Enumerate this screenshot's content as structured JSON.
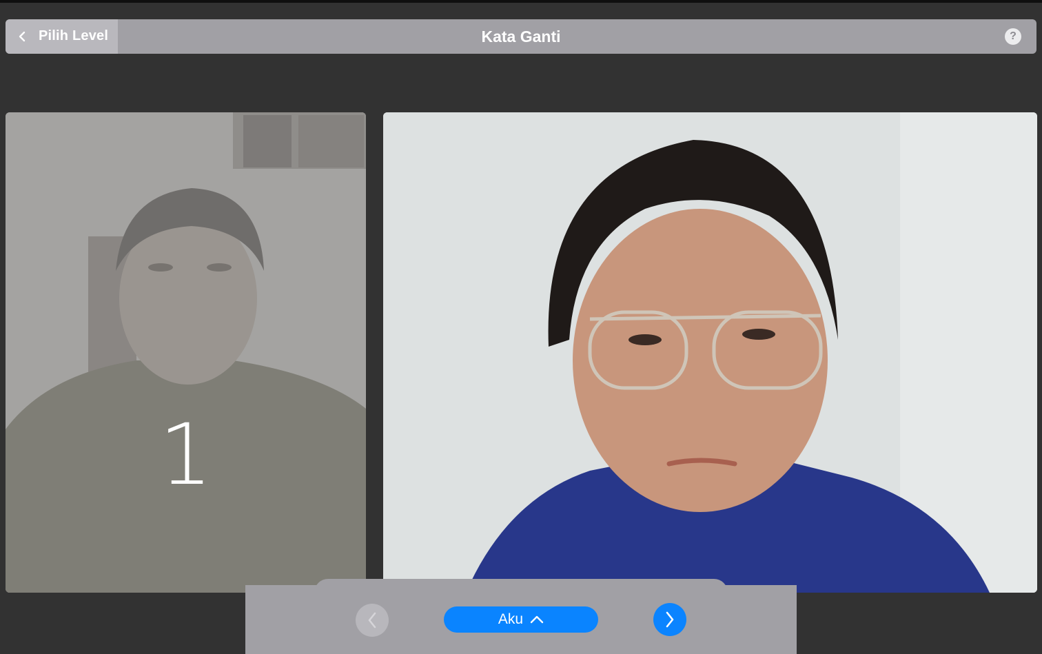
{
  "header": {
    "back_label": "Pilih Level",
    "title": "Kata Ganti",
    "help_icon": "question-mark-icon",
    "help_glyph": "?"
  },
  "video": {
    "countdown": "1"
  },
  "controls": {
    "word_label": "Aku",
    "prev_icon": "chevron-left-icon",
    "next_icon": "chevron-right-icon",
    "expand_icon": "chevron-up-icon"
  },
  "colors": {
    "accent": "#0a84ff",
    "header_bg": "#a1a0a5",
    "background": "#323232"
  }
}
